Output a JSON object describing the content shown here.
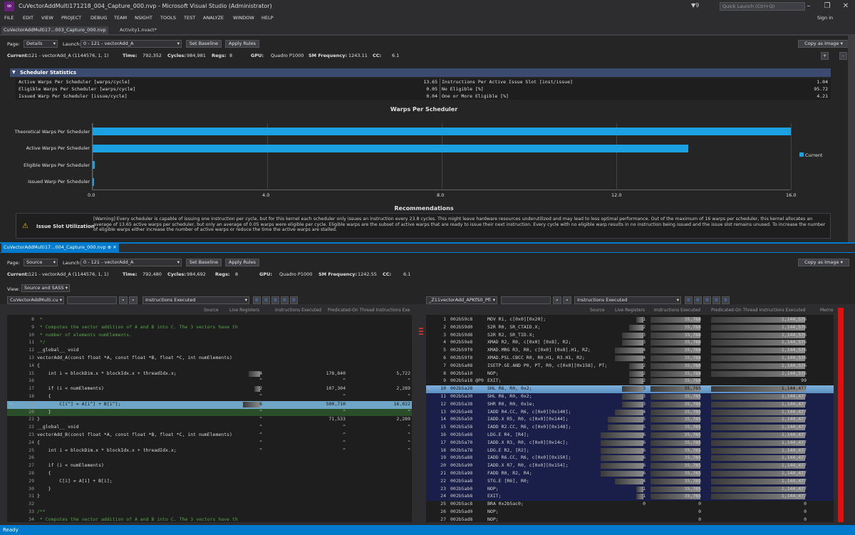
{
  "window": {
    "title": "CuVectorAddMulti171218_004_Capture_000.nvp - Microsoft Visual Studio (Administrator)",
    "notifications": "9",
    "quick_launch_placeholder": "Quick Launch (Ctrl+Q)",
    "sign_in": "Sign in",
    "minimize": "–",
    "maximize": "❐",
    "close": "✕"
  },
  "menu": [
    "FILE",
    "EDIT",
    "VIEW",
    "PROJECT",
    "DEBUG",
    "TEAM",
    "NSIGHT",
    "TOOLS",
    "TEST",
    "ANALYZE",
    "WINDOW",
    "HELP"
  ],
  "top_tabs": [
    {
      "label": "CuVectorAddMulti17...003_Capture_000.nvp"
    },
    {
      "label": "Activity1.nvact*"
    }
  ],
  "pane1": {
    "page_label": "Page:",
    "page_value": "Details",
    "launch_label": "Launch:",
    "launch_value": "0 - 121 - vectorAdd_A",
    "set_baseline": "Set Baseline",
    "apply_rules": "Apply Rules",
    "copy_as_image": "Copy as Image",
    "current_label": "Current:",
    "current_value": "121 - vectorAdd_A (1144576,   1,   1)",
    "time_label": "Time:",
    "time_value": "792,352",
    "cycles_label": "Cycles:",
    "cycles_value": "984,981",
    "regs_label": "Regs:",
    "regs_value": "8",
    "gpu_label": "GPU:",
    "gpu_value": "Quadro P1000",
    "smfreq_label": "SM Frequency:",
    "smfreq_value": "1243.11",
    "cc_label": "CC:",
    "cc_value": "6.1",
    "section_title": "Scheduler Statistics",
    "stats_left": [
      {
        "label": "Active Warps Per Scheduler [warps/cycle]",
        "value": "13.65"
      },
      {
        "label": "Eligible Warps Per Scheduler [warps/cycle]",
        "value": "0.05"
      },
      {
        "label": "Issued Warp Per Scheduler [issue/cycle]",
        "value": "0.04"
      }
    ],
    "stats_right": [
      {
        "label": "Instructions Per Active Issue Slot [inst/issue]",
        "value": "1.04"
      },
      {
        "label": "No Eligible [%]",
        "value": "95.72"
      },
      {
        "label": "One or More Eligible [%]",
        "value": "4.21"
      }
    ],
    "recommendations_title": "Recommendations",
    "rec_name": "Issue Slot Utilization",
    "rec_text": "[Warning] Every scheduler is capable of issuing one instruction per cycle, but for this kernel each scheduler only issues an instruction every 23.8 cycles. This might leave hardware resources underutilized and may lead to less optimal performance. Out of the maximum of 16 warps per scheduler, this kernel allocates an average of 13.65 active warps per scheduler, but only an average of 0.05 warps were eligible per cycle. Eligible warps are the subset of active warps that are ready to issue their next instruction. Every cycle with no eligible warp results in no instruction being issued and the issue slot remains unused. To increase the number of eligible warps either increase the number of active warps or reduce the time the active warps are stalled.",
    "add_btn": "+",
    "minus_btn": "-"
  },
  "chart_data": {
    "type": "bar",
    "title": "Warps Per Scheduler",
    "orientation": "horizontal",
    "categories": [
      "Theoretical Warps Per Scheduler",
      "Active Warps Per Scheduler",
      "Eligible Warps Per Scheduler",
      "Issued Warp Per Scheduler"
    ],
    "series": [
      {
        "name": "Current",
        "values": [
          16.0,
          13.65,
          0.05,
          0.04
        ]
      }
    ],
    "xlim": [
      0,
      16
    ],
    "xticks": [
      "0.0",
      "4.0",
      "8.0",
      "12.0",
      "16.0"
    ],
    "legend": "right",
    "colors": {
      "Current": "#1ba1e2"
    },
    "grid": true
  },
  "pane2": {
    "tab": "CuVectorAddMulti17...004_Capture_000.nvp",
    "tab_pin": "⊕",
    "tab_close": "✕",
    "page_label": "Page:",
    "page_value": "Source",
    "launch_label": "Launch:",
    "launch_value": "0 - 121 - vectorAdd_A",
    "set_baseline": "Set Baseline",
    "apply_rules": "Apply Rules",
    "copy_as_image": "Copy as Image",
    "current_label": "Current:",
    "current_value": "121 - vectorAdd_A (1144576,   1,   1)",
    "time_label": "Time:",
    "time_value": "792,480",
    "cycles_label": "Cycles:",
    "cycles_value": "984,692",
    "regs_label": "Regs:",
    "regs_value": "8",
    "gpu_label": "GPU:",
    "gpu_value": "Quadro P1000",
    "smfreq_label": "SM Frequency:",
    "smfreq_value": "1242.55",
    "cc_label": "CC:",
    "cc_value": "6.1",
    "view_label": "View:",
    "view_value": "Source and SASS",
    "src_file": "CuVectorAddMulti.cu",
    "src_metric": "Instructions Executed",
    "sass_func": "_Z11vectorAdd_APKfS0_Pfi",
    "sass_metric": "Instructions Executed",
    "src_headers": [
      "Source",
      "Live Registers",
      "Instructions Executed",
      "Predicated-On Thread Instructions Exe"
    ],
    "sass_headers": [
      "Source",
      "Live Registers",
      "Instructions Executed",
      "Predicated-On Thread Instructions Executed",
      "Memo"
    ]
  },
  "source_lines": [
    {
      "ln": "8",
      "code": " *"
    },
    {
      "ln": "9",
      "code": " * Computes the vector addition of A and B into C. The 3 vectors have th"
    },
    {
      "ln": "10",
      "code": " * number of elements numElements."
    },
    {
      "ln": "11",
      "code": " */"
    },
    {
      "ln": "12",
      "code": "__global__ void"
    },
    {
      "ln": "13",
      "code": "vectorAdd_A(const float *A, const float *B, float *C, int numElements)"
    },
    {
      "ln": "14",
      "code": "{"
    },
    {
      "ln": "15",
      "code": "    int i = blockDim.x * blockIdx.x + threadIdx.x;",
      "regs": "4",
      "inst": "178,840",
      "pred": "5,722"
    },
    {
      "ln": "16",
      "code": "",
      "regs": "^",
      "inst": "^",
      "pred": "^"
    },
    {
      "ln": "17",
      "code": "    if (i < numElements)",
      "regs": "2",
      "inst": "107,304",
      "pred": "2,289"
    },
    {
      "ln": "18",
      "code": "    {",
      "regs": "^",
      "inst": "^",
      "pred": "^"
    },
    {
      "ln": "19",
      "code": "        C[i^] = A[i^] + B[i^];",
      "regs": "6",
      "inst": "500,710",
      "pred": "16,022"
    },
    {
      "ln": "20",
      "code": "    }",
      "regs": "^",
      "inst": "^",
      "pred": "^"
    },
    {
      "ln": "21",
      "code": "}",
      "regs": "^",
      "inst": "71,533",
      "pred": "2,289"
    },
    {
      "ln": "22",
      "code": "__global__ void",
      "regs": "^",
      "inst": "^",
      "pred": "^"
    },
    {
      "ln": "23",
      "code": "vectorAdd_B(const float *A, const float *B, float *C, int numElements)",
      "regs": "^",
      "inst": "^",
      "pred": "^"
    },
    {
      "ln": "24",
      "code": "{",
      "regs": "^",
      "inst": "^",
      "pred": "^"
    },
    {
      "ln": "25",
      "code": "    int i = blockDim.x * blockIdx.x + threadIdx.x;",
      "regs": "^",
      "inst": "^",
      "pred": "^"
    },
    {
      "ln": "26",
      "code": ""
    },
    {
      "ln": "27",
      "code": "    if (i < numElements)"
    },
    {
      "ln": "28",
      "code": "    {"
    },
    {
      "ln": "29",
      "code": "        C[i] = A[i] + B[i];"
    },
    {
      "ln": "30",
      "code": "    }"
    },
    {
      "ln": "31",
      "code": "}"
    },
    {
      "ln": "32",
      "code": ""
    },
    {
      "ln": "33",
      "code": "/**"
    },
    {
      "ln": "34",
      "code": " * Computes the vector addition of A and B into C. The 3 vectors have th"
    }
  ],
  "sass_lines": [
    {
      "n": "1",
      "addr": "002b59c8",
      "ins": "MOV R1, c[0x0][0x20];",
      "regs": "1",
      "inst": "35,768",
      "pred": "1,144,576"
    },
    {
      "n": "2",
      "addr": "002b59d0",
      "ins": "S2R R0, SR_CTAID.X;",
      "regs": "2",
      "inst": "35,768",
      "pred": "1,144,576"
    },
    {
      "n": "3",
      "addr": "002b59d8",
      "ins": "S2R R2, SR_TID.X;",
      "regs": "3",
      "inst": "35,768",
      "pred": "1,144,576"
    },
    {
      "n": "4",
      "addr": "002b59e8",
      "ins": "XMAD R2, R0, c[0x0] [0x8], R2;",
      "regs": "3",
      "inst": "35,768",
      "pred": "1,144,576"
    },
    {
      "n": "5",
      "addr": "002b59f0",
      "ins": "XMAD.MRG R3, R0, c[0x0] [0x8].H1, RZ;",
      "regs": "4",
      "inst": "35,768",
      "pred": "1,144,576"
    },
    {
      "n": "6",
      "addr": "002b59f8",
      "ins": "XMAD.PSL.CBCC R0, R0.H1, R3.H1, R2;",
      "regs": "4",
      "inst": "35,768",
      "pred": "1,144,576"
    },
    {
      "n": "7",
      "addr": "002b5a08",
      "ins": "ISETP.GE.AND P0, PT, R0, c[0x0][0x158], PT;",
      "regs": "2",
      "inst": "35,768",
      "pred": "1,144,576"
    },
    {
      "n": "8",
      "addr": "002b5a10",
      "ins": "NOP;",
      "regs": "2",
      "inst": "35,768",
      "pred": "1,144,576"
    },
    {
      "n": "9",
      "addr": "002b5a18 @P0",
      "ins": "EXIT;",
      "regs": "2",
      "inst": "35,768",
      "pred": "99"
    },
    {
      "n": "10",
      "addr": "002b5a28",
      "ins": "SHL R6, R0, 0x2;",
      "regs": "3",
      "inst": "35,765",
      "pred": "1,144,477"
    },
    {
      "n": "11",
      "addr": "002b5a30",
      "ins": "SHL R6, R0, 0x2;",
      "regs": "3",
      "inst": "35,765",
      "pred": "1,144,477"
    },
    {
      "n": "12",
      "addr": "002b5a38",
      "ins": "SHR R0, R0, 0x1e;",
      "regs": "3",
      "inst": "35,765",
      "pred": "1,144,477"
    },
    {
      "n": "13",
      "addr": "002b5a48",
      "ins": "IADD R4.CC, R6, c[0x0][0x140];",
      "regs": "4",
      "inst": "35,765",
      "pred": "1,144,477"
    },
    {
      "n": "14",
      "addr": "002b5a50",
      "ins": "IADD.X R5, R0, c[0x0][0x144];",
      "regs": "5",
      "inst": "35,765",
      "pred": "1,144,477"
    },
    {
      "n": "15",
      "addr": "002b5a58",
      "ins": "IADD R2.CC, R6, c[0x0][0x148];",
      "regs": "5",
      "inst": "35,765",
      "pred": "1,144,477"
    },
    {
      "n": "16",
      "addr": "002b5a68",
      "ins": "LDG.E R4, [R4];",
      "regs": "6",
      "inst": "35,765",
      "pred": "1,144,477"
    },
    {
      "n": "17",
      "addr": "002b5a70",
      "ins": "IADD.X R3, R0, c[0x0][0x14c];",
      "regs": "6",
      "inst": "35,765",
      "pred": "1,144,477"
    },
    {
      "n": "18",
      "addr": "002b5a78",
      "ins": "LDG.E R2, [R2];",
      "regs": "6",
      "inst": "35,765",
      "pred": "1,144,477"
    },
    {
      "n": "19",
      "addr": "002b5a88",
      "ins": "IADD R6.CC, R6, c[0x0][0x150];",
      "regs": "6",
      "inst": "35,765",
      "pred": "1,144,477"
    },
    {
      "n": "20",
      "addr": "002b5a90",
      "ins": "IADD.X R7, R0, c[0x0][0x154];",
      "regs": "6",
      "inst": "35,765",
      "pred": "1,144,477"
    },
    {
      "n": "21",
      "addr": "002b5a98",
      "ins": "FADD R0, R2, R4;",
      "regs": "6",
      "inst": "35,765",
      "pred": "1,144,477"
    },
    {
      "n": "22",
      "addr": "002b5aa8",
      "ins": "STG.E [R6], R0;",
      "regs": "4",
      "inst": "35,765",
      "pred": "1,144,477"
    },
    {
      "n": "23",
      "addr": "002b5ab0",
      "ins": "NOP;",
      "regs": "1",
      "inst": "35,765",
      "pred": "1,144,477"
    },
    {
      "n": "24",
      "addr": "002b5ab8",
      "ins": "EXIT;",
      "regs": "1",
      "inst": "35,765",
      "pred": "1,144,477"
    },
    {
      "n": "25",
      "addr": "002b5ac8",
      "ins": "BRA 0x2b5ac0;",
      "regs": "0",
      "inst": "0",
      "pred": "0"
    },
    {
      "n": "26",
      "addr": "002b5ad0",
      "ins": "NOP;",
      "regs": "",
      "inst": "0",
      "pred": "0"
    },
    {
      "n": "27",
      "addr": "002b5ad8",
      "ins": "NOP;",
      "regs": "",
      "inst": "0",
      "pred": "0"
    }
  ],
  "status": "Ready"
}
